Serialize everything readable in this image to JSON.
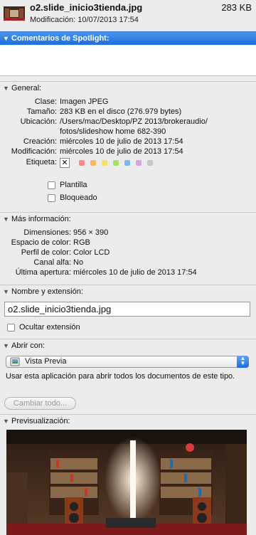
{
  "header": {
    "filename": "o2.slide_inicio3tienda.jpg",
    "size": "283 KB",
    "modified_label": "Modificación:",
    "modified_value": "10/07/2013 17:54"
  },
  "sections": {
    "spotlight": "Comentarios de Spotlight:",
    "general": "General:",
    "more_info": "Más información:",
    "name_ext": "Nombre y extensión:",
    "open_with": "Abrir con:",
    "preview": "Previsualización:"
  },
  "general": {
    "rows": [
      {
        "k": "Clase:",
        "v": "Imagen JPEG"
      },
      {
        "k": "Tamaño:",
        "v": "283 KB en el disco (276.979 bytes)"
      },
      {
        "k": "Ubicación:",
        "v": "/Users/mac/Desktop/PZ 2013/brokeraudio/"
      },
      {
        "k": "",
        "v": "fotos/slideshow home 682-390"
      },
      {
        "k": "Creación:",
        "v": "miércoles 10 de julio de 2013 17:54"
      },
      {
        "k": "Modificación:",
        "v": "miércoles 10 de julio de 2013 17:54"
      }
    ],
    "tag_label": "Etiqueta:",
    "tag_none": "✕",
    "tag_colors": [
      "#f48f86",
      "#f7b964",
      "#f3e36a",
      "#a9e06a",
      "#80b6f2",
      "#d6a3e6",
      "#c8c8c8"
    ],
    "template_label": "Plantilla",
    "locked_label": "Bloqueado"
  },
  "more_info": {
    "rows": [
      {
        "k": "Dimensiones:",
        "v": "956 × 390"
      },
      {
        "k": "Espacio de color:",
        "v": "RGB"
      },
      {
        "k": "Perfil de color:",
        "v": "Color LCD"
      },
      {
        "k": "Canal alfa:",
        "v": "No"
      },
      {
        "k": "Última apertura:",
        "v": "miércoles 10 de julio de 2013 17:54"
      }
    ]
  },
  "name_ext": {
    "value": "o2.slide_inicio3tienda.jpg",
    "hide_ext_label": "Ocultar extensión"
  },
  "open_with": {
    "app": "Vista Previa",
    "description": "Usar esta aplicación para abrir todos los documentos de este tipo.",
    "change_all": "Cambiar todo..."
  },
  "icons": {
    "disclosure": "▼"
  },
  "colors": {
    "selection": "#1c6fe0"
  }
}
